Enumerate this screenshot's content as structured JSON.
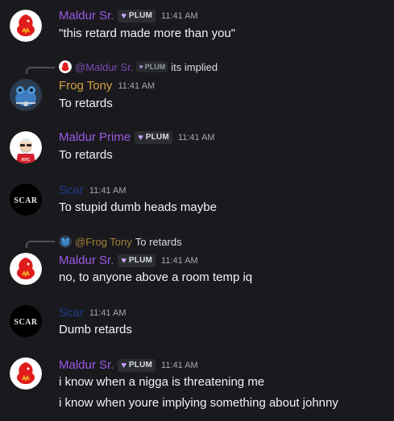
{
  "colors": {
    "background": "#1a1a1e",
    "maldur": "#9b59e5",
    "frog": "#d4a040",
    "scar": "#1f3a8a",
    "badge_heart": "#c9a5ff"
  },
  "messages": [
    {
      "author": "Maldur Sr.",
      "badge": "PLUM",
      "time": "11:41 AM",
      "lines": [
        "\"this retard made more than you\""
      ],
      "avatar_icon": "red-bird-avatar-icon"
    },
    {
      "reply": {
        "author": "@Maldur Sr.",
        "badge": "PLUM",
        "text": "its implied"
      },
      "author": "Frog Tony",
      "time": "11:41 AM",
      "lines": [
        "To retards"
      ],
      "avatar_icon": "frog-avatar-icon"
    },
    {
      "author": "Maldur Prime",
      "badge": "PLUM",
      "time": "11:41 AM",
      "lines": [
        "To retards"
      ],
      "avatar_icon": "colonel-avatar-icon"
    },
    {
      "author": "Scar",
      "time": "11:41 AM",
      "lines": [
        "To stupid dumb heads maybe"
      ],
      "avatar_icon": "scar-logo-avatar-icon",
      "avatar_text": "SCAR"
    },
    {
      "reply": {
        "author": "@Frog Tony",
        "text": "To retards"
      },
      "author": "Maldur Sr.",
      "badge": "PLUM",
      "time": "11:41 AM",
      "lines": [
        "no, to anyone above a room temp iq"
      ],
      "avatar_icon": "red-bird-avatar-icon"
    },
    {
      "author": "Scar",
      "time": "11:41 AM",
      "lines": [
        "Dumb retards"
      ],
      "avatar_icon": "scar-logo-avatar-icon",
      "avatar_text": "SCAR"
    },
    {
      "author": "Maldur Sr.",
      "badge": "PLUM",
      "time": "11:41 AM",
      "lines": [
        "i know when a nigga is threatening me",
        "i know when youre implying something about johnny"
      ],
      "avatar_icon": "red-bird-avatar-icon"
    }
  ]
}
